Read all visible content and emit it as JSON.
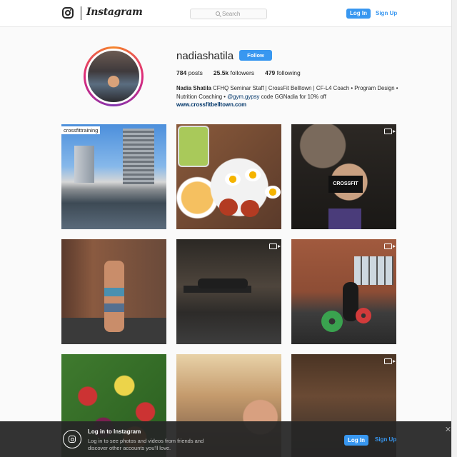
{
  "nav": {
    "logo_icon": "instagram-glyph-icon",
    "wordmark": "Instagram",
    "search_placeholder": "Search",
    "login_label": "Log In",
    "signup_label": "Sign Up"
  },
  "profile": {
    "username": "nadiashatila",
    "follow_label": "Follow",
    "stats": {
      "posts_count": "784",
      "posts_label": "posts",
      "followers_count": "25.5k",
      "followers_label": "followers",
      "following_count": "479",
      "following_label": "following"
    },
    "bio": {
      "name": "Nadia Shatila",
      "text_part1": " CFHQ Seminar Staff | CrossFit Belltown | CF-L4 Coach • Program Design • Nutrition Coaching • ",
      "mention": "@gym.gypsy",
      "text_part2": " code GGNadia for 10% off"
    },
    "link": "www.crossfitbelltown.com"
  },
  "posts": [
    {
      "id": 1,
      "caption": "crossfittraining",
      "video": false
    },
    {
      "id": 2,
      "video": false
    },
    {
      "id": 3,
      "overlay_text": "CROSSFIT",
      "video": true
    },
    {
      "id": 4,
      "video": false
    },
    {
      "id": 5,
      "video": true
    },
    {
      "id": 6,
      "video": true
    },
    {
      "id": 7,
      "video": false
    },
    {
      "id": 8,
      "video": false
    },
    {
      "id": 9,
      "video": true
    }
  ],
  "banner": {
    "title": "Log in to Instagram",
    "text": "Log in to see photos and videos from friends and discover other accounts you'll love.",
    "login_label": "Log In",
    "signup_label": "Sign Up"
  },
  "colors": {
    "accent": "#3897f0",
    "link": "#003569",
    "banner_bg": "#262626"
  }
}
